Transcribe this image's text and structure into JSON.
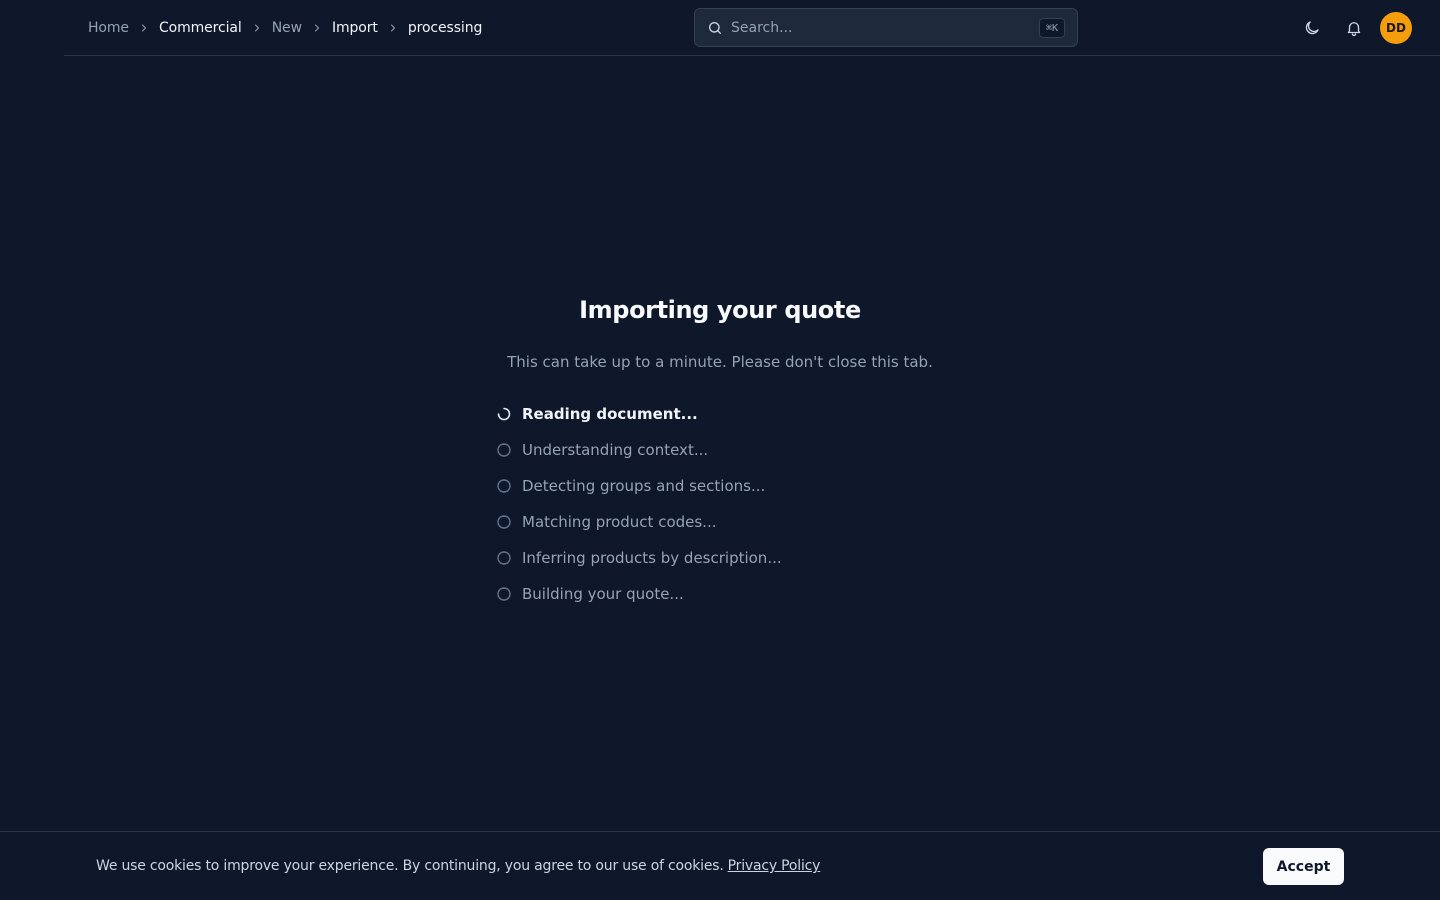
{
  "breadcrumb": {
    "items": [
      {
        "label": "Home"
      },
      {
        "label": "Commercial"
      },
      {
        "label": "New"
      },
      {
        "label": "Import"
      },
      {
        "label": "processing"
      }
    ]
  },
  "search": {
    "placeholder": "Search...",
    "shortcut": "⌘K"
  },
  "header": {
    "theme_icon": "moon-icon",
    "notifications_icon": "bell-icon",
    "avatar_initials": "DD",
    "avatar_color": "#f59e0b"
  },
  "main": {
    "title": "Importing your quote",
    "subtitle": "This can take up to a minute. Please don't close this tab.",
    "steps": [
      {
        "label": "Reading document...",
        "state": "in-progress"
      },
      {
        "label": "Understanding context...",
        "state": "pending"
      },
      {
        "label": "Detecting groups and sections...",
        "state": "pending"
      },
      {
        "label": "Matching product codes...",
        "state": "pending"
      },
      {
        "label": "Inferring products by description...",
        "state": "pending"
      },
      {
        "label": "Building your quote...",
        "state": "pending"
      }
    ]
  },
  "cookie_banner": {
    "text": "We use cookies to improve your experience. By continuing, you agree to our use of cookies.",
    "link_label": "Privacy Policy",
    "accept_label": "Accept"
  },
  "colors": {
    "background": "#0f172a",
    "muted_text": "#94a3b8",
    "accent": "#f59e0b"
  }
}
